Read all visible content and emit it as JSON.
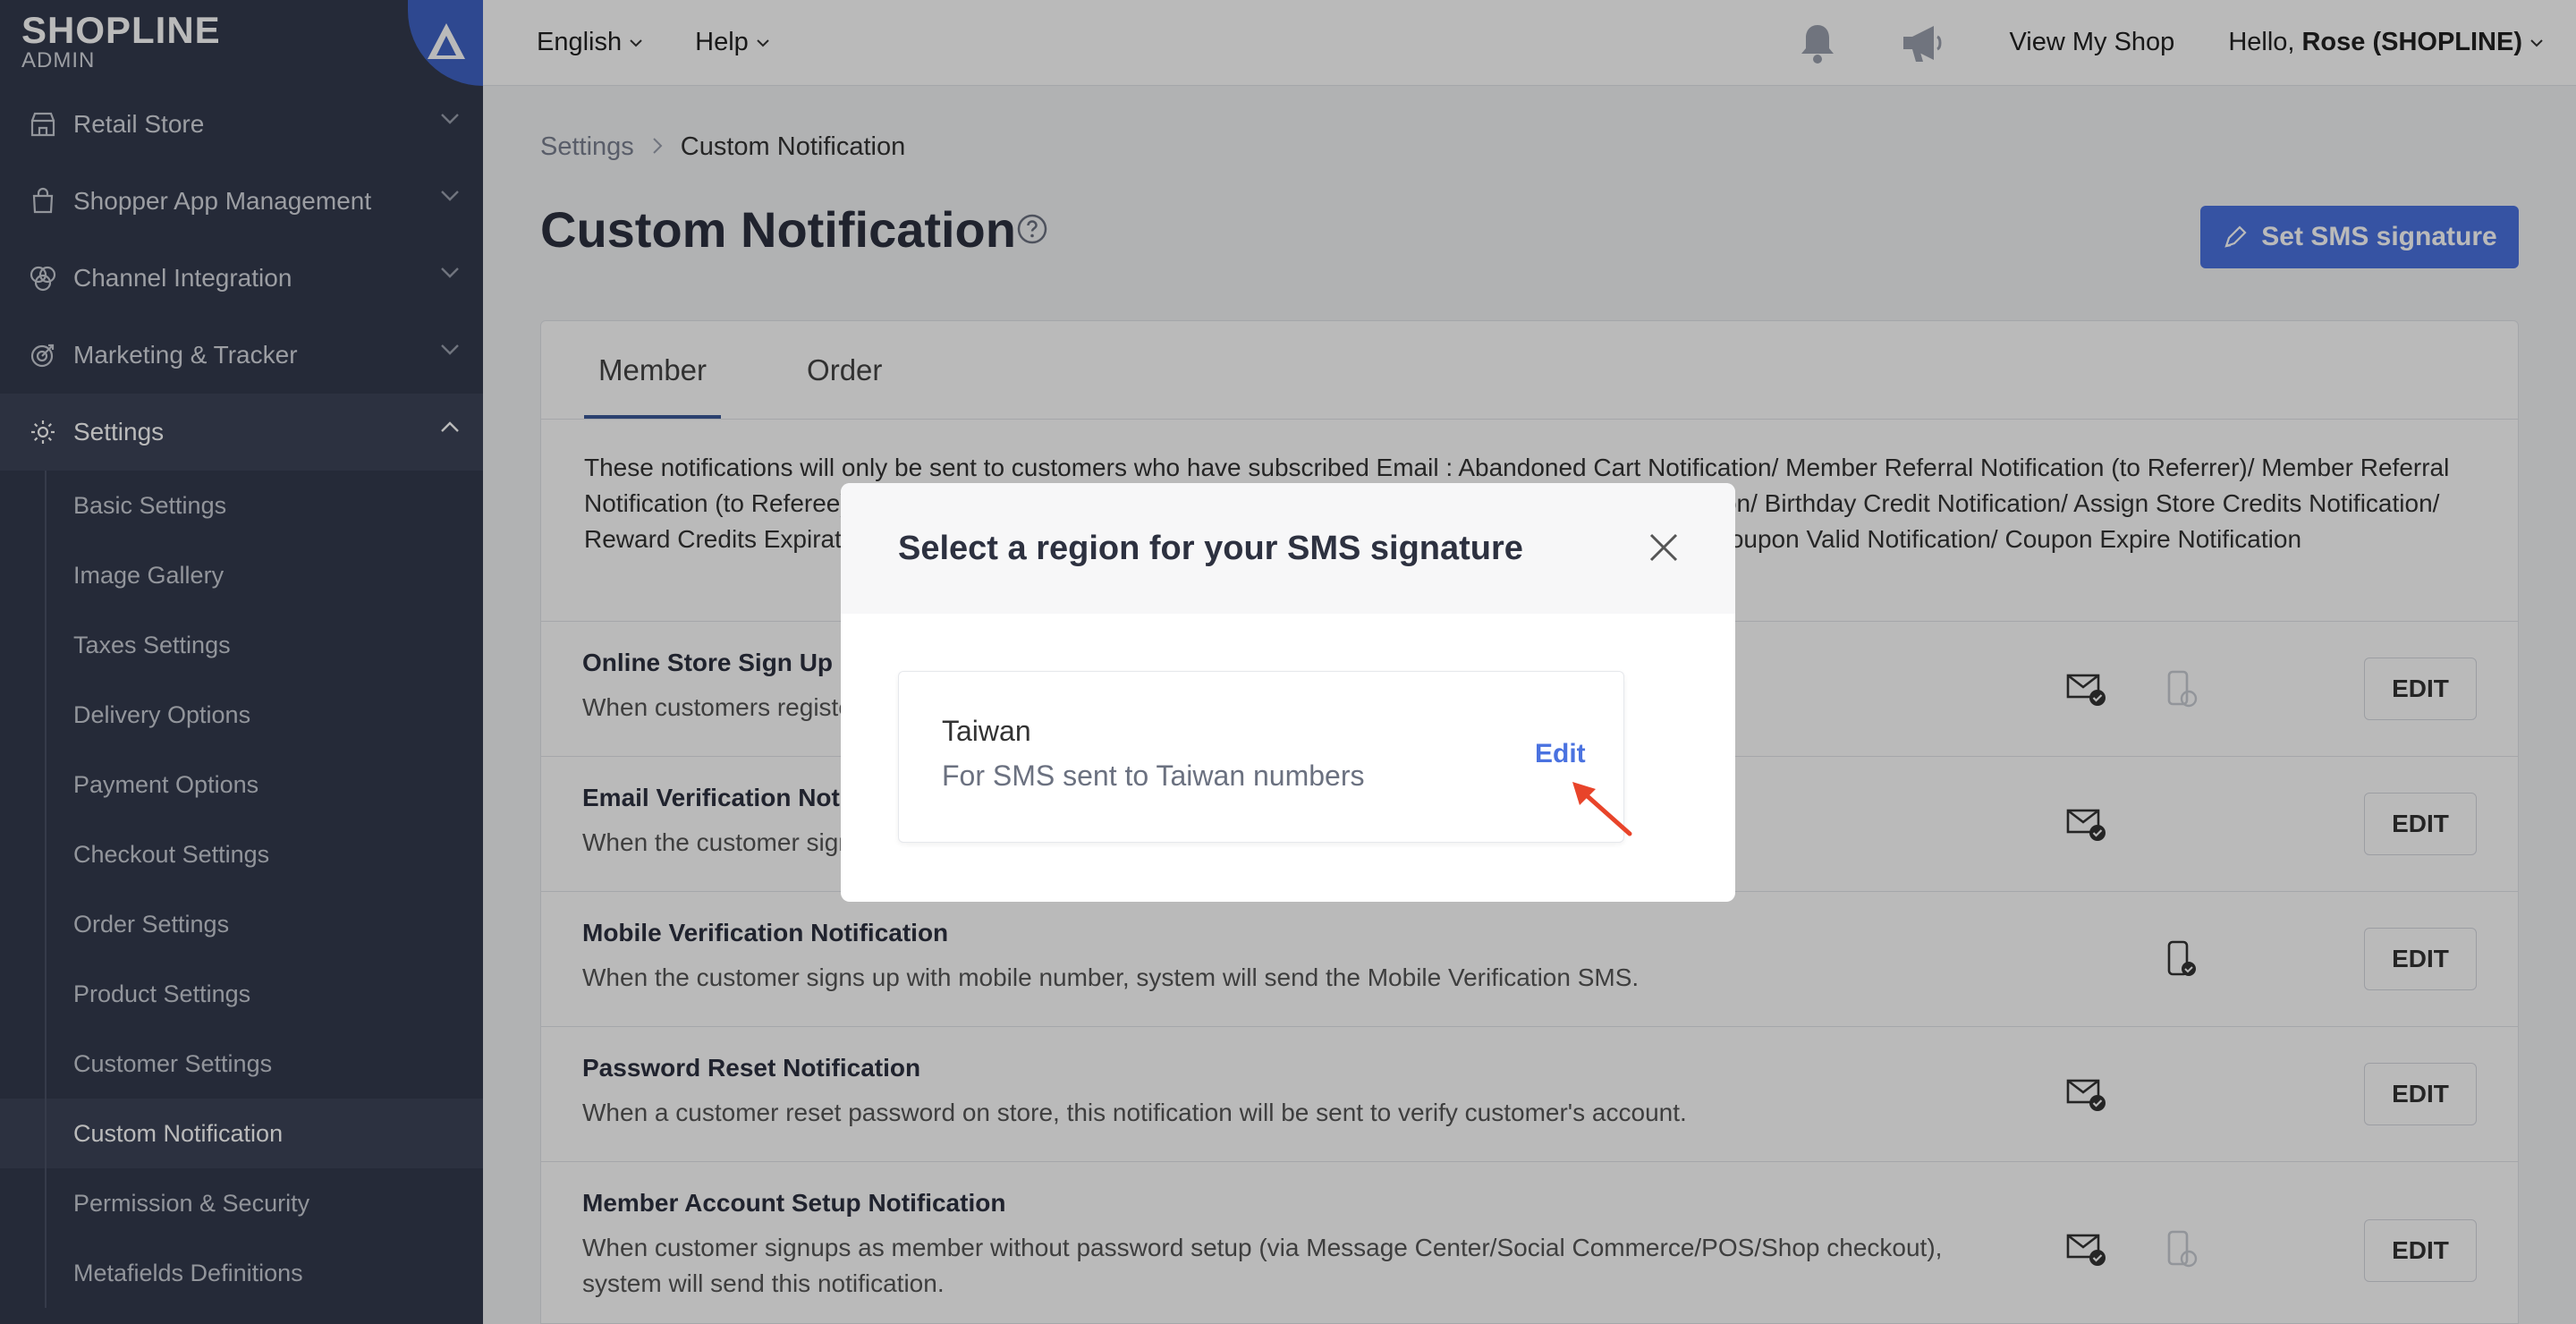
{
  "logo": {
    "brand": "SHOPLINE",
    "sub": "ADMIN"
  },
  "sidebar": {
    "items": [
      {
        "label": "Retail Store",
        "icon": "store-icon"
      },
      {
        "label": "Shopper App Management",
        "icon": "bag-icon"
      },
      {
        "label": "Channel Integration",
        "icon": "channel-icon"
      },
      {
        "label": "Marketing & Tracker",
        "icon": "target-icon"
      },
      {
        "label": "Settings",
        "icon": "gear-icon"
      }
    ],
    "settings_sub": [
      "Basic Settings",
      "Image Gallery",
      "Taxes Settings",
      "Delivery Options",
      "Payment Options",
      "Checkout Settings",
      "Order Settings",
      "Product Settings",
      "Customer Settings",
      "Custom Notification",
      "Permission & Security",
      "Metafields Definitions"
    ]
  },
  "topbar": {
    "language": "English",
    "help": "Help",
    "view_shop": "View My Shop",
    "hello": "Hello,",
    "user": "Rose (SHOPLINE)"
  },
  "breadcrumb": {
    "parent": "Settings",
    "separator": ">",
    "current": "Custom Notification"
  },
  "page": {
    "title": "Custom Notification",
    "sms_button": "Set SMS signature"
  },
  "tabs": [
    "Member",
    "Order"
  ],
  "notice": "These notifications will only be sent to customers who have subscribed Email : Abandoned Cart Notification/ Member Referral Notification (to Referrer)/ Member Referral Notification (to Referee)/ Reward Notification/ Member Tier Upgrade Notification/ Membership Notification/ Birthday Credit Notification/ Assign Store Credits Notification/ Reward Credits Expiration Notification/ Assign Member Points Notification/ Send Coupon Notification/ Coupon Valid Notification/ Coupon Expire Notification",
  "rows": [
    {
      "title": "Online Store Sign Up Notification",
      "desc": "When customers register on the online store, system will send the sign up notification."
    },
    {
      "title": "Email Verification Notification",
      "desc": "When the customer signs up with email, system will send the Email Verification."
    },
    {
      "title": "Mobile Verification Notification",
      "desc": "When the customer signs up with mobile number, system will send the Mobile Verification SMS."
    },
    {
      "title": "Password Reset Notification",
      "desc": "When a customer reset password on store, this notification will be sent to verify customer's account."
    },
    {
      "title": "Member Account Setup Notification",
      "desc": "When customer signups as member without password setup (via Message Center/Social Commerce/POS/Shop checkout), system will send this notification."
    }
  ],
  "edit_label": "EDIT",
  "modal": {
    "title": "Select a region for your SMS signature",
    "region_name": "Taiwan",
    "region_desc": "For SMS sent to Taiwan numbers",
    "edit": "Edit"
  },
  "colors": {
    "sidebar": "#333a4d",
    "accent": "#4a72e0",
    "annotation": "#e8442a"
  }
}
